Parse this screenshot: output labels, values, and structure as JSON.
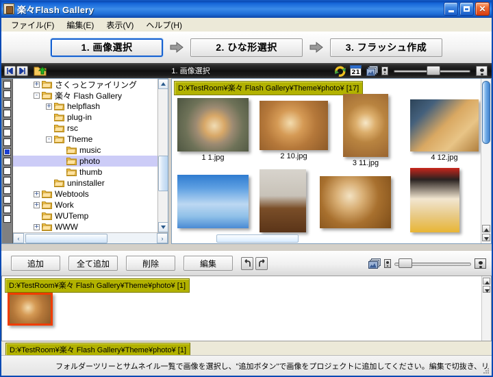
{
  "window": {
    "title": "楽々Flash Gallery",
    "icon": "app-icon",
    "controls": {
      "minimize": "_",
      "maximize": "□",
      "close": "✕"
    }
  },
  "menubar": {
    "items": [
      {
        "label": "ファイル(F)",
        "name": "menu-file"
      },
      {
        "label": "編集(E)",
        "name": "menu-edit"
      },
      {
        "label": "表示(V)",
        "name": "menu-view"
      },
      {
        "label": "ヘルプ(H)",
        "name": "menu-help"
      }
    ]
  },
  "steps": [
    {
      "label": "1. 画像選択",
      "active": true
    },
    {
      "label": "2. ひな形選択",
      "active": false
    },
    {
      "label": "3. フラッシュ作成",
      "active": false
    }
  ],
  "darkbar": {
    "title": "1. 画像選択",
    "back_icon": "prev-icon",
    "forward_icon": "next-icon",
    "folder_up_icon": "folder-up-icon",
    "refresh_icon": "rotate-icon",
    "calendar_icon": "calendar-21-icon",
    "slideshow_icon": "slideshow-icon",
    "slider_value": "45",
    "small_person_icon": "person-small-icon",
    "large_person_icon": "person-large-icon"
  },
  "tree": {
    "rows": [
      {
        "indent": 2,
        "expander": "+",
        "label": "さくっとファイリング",
        "selected": false
      },
      {
        "indent": 2,
        "expander": "-",
        "label": "楽々 Flash Gallery",
        "selected": false
      },
      {
        "indent": 3,
        "expander": "+",
        "label": "helpflash",
        "selected": false
      },
      {
        "indent": 3,
        "expander": "",
        "label": "plug-in",
        "selected": false
      },
      {
        "indent": 3,
        "expander": "",
        "label": "rsc",
        "selected": false
      },
      {
        "indent": 3,
        "expander": "-",
        "label": "Theme",
        "selected": false
      },
      {
        "indent": 4,
        "expander": "",
        "label": "music",
        "selected": false
      },
      {
        "indent": 4,
        "expander": "",
        "label": "photo",
        "selected": true
      },
      {
        "indent": 4,
        "expander": "",
        "label": "thumb",
        "selected": false
      },
      {
        "indent": 3,
        "expander": "",
        "label": "uninstaller",
        "selected": false
      },
      {
        "indent": 2,
        "expander": "+",
        "label": "Webtools",
        "selected": false
      },
      {
        "indent": 2,
        "expander": "+",
        "label": "Work",
        "selected": false
      },
      {
        "indent": 2,
        "expander": "",
        "label": "WUTemp",
        "selected": false
      },
      {
        "indent": 2,
        "expander": "+",
        "label": "WWW",
        "selected": false
      }
    ]
  },
  "thumbpanel": {
    "path": "D:¥TestRoom¥楽々 Flash Gallery¥Theme¥photo¥ [17]",
    "thumbs": [
      {
        "caption": "1 1.jpg",
        "kind": "dog-rock"
      },
      {
        "caption": "2 10.jpg",
        "kind": "dog-floor"
      },
      {
        "caption": "3 11.jpg",
        "kind": "dog-top"
      },
      {
        "caption": "4 12.jpg",
        "kind": "dog-wood"
      },
      {
        "caption": "",
        "kind": "sky"
      },
      {
        "caption": "",
        "kind": "puppy-sit"
      },
      {
        "caption": "",
        "kind": "puppy-lie"
      },
      {
        "caption": "",
        "kind": "puppy-yellow"
      }
    ]
  },
  "actionbar": {
    "buttons": [
      {
        "label": "追加",
        "name": "add-button"
      },
      {
        "label": "全て追加",
        "name": "add-all-button"
      },
      {
        "label": "削除",
        "name": "delete-button"
      },
      {
        "label": "編集",
        "name": "edit-button"
      }
    ],
    "undo_icon": "undo-icon",
    "redo_icon": "redo-icon",
    "monitor_icon": "slideshow-icon",
    "slider_value": "5"
  },
  "project": {
    "path_top": "D:¥TestRoom¥楽々 Flash Gallery¥Theme¥photo¥ [1]",
    "path_bottom": "D:¥TestRoom¥楽々 Flash Gallery¥Theme¥photo¥ [1]",
    "items": [
      {
        "kind": "dog-floor",
        "selected": true
      }
    ]
  },
  "status": {
    "message": "フォルダーツリーとサムネイル一覧で画像を選択し、\"追加ボタン\"で画像をプロジェクトに追加してください。編集で切抜き、リ"
  },
  "colors": {
    "titlebar_blue": "#1565d8",
    "path_olive": "#b2b200",
    "selection_lavender": "#ccccf7",
    "selected_thumb_border": "#f03c00",
    "active_step_border": "#1560d0"
  }
}
